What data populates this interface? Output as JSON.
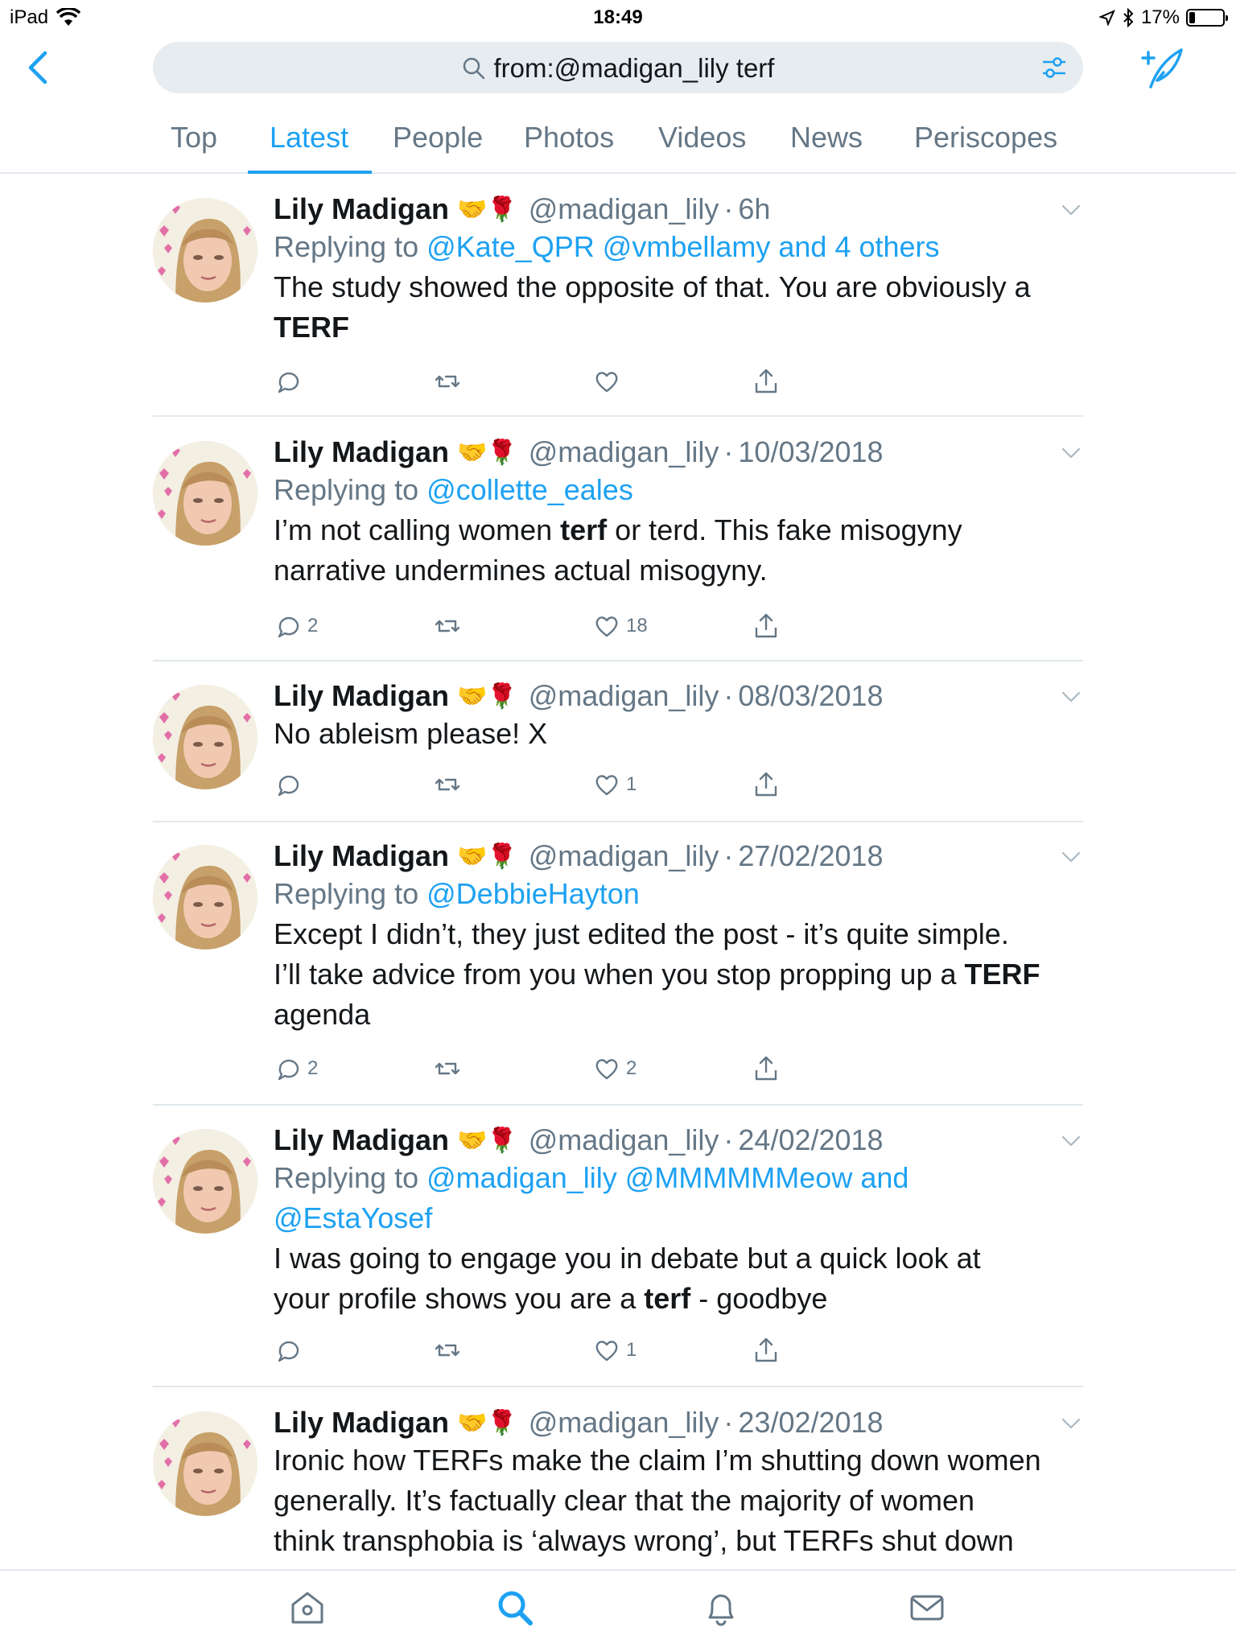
{
  "status_bar": {
    "device": "iPad",
    "time": "18:49",
    "battery": "17%",
    "battery_level": 0.17
  },
  "search": {
    "query": "from:@madigan_lily terf",
    "icon": "search-icon",
    "filter_icon": "filter-icon"
  },
  "tabs": [
    "Top",
    "Latest",
    "People",
    "Photos",
    "Videos",
    "News",
    "Periscopes"
  ],
  "active_tab": "Latest",
  "tweets": [
    {
      "name": "Lily Madigan",
      "emoji": "🤝🌹",
      "handle": "@madigan_lily",
      "dot": "·",
      "time": "6h",
      "replying_prefix": "Replying to",
      "replying": [
        {
          "text": "@Kate_QPR",
          "sep": " "
        },
        {
          "text": "@vmbellamy",
          "sep": " "
        },
        {
          "text": "and 4 others",
          "sep": ""
        }
      ],
      "text_lines": [
        [
          {
            "t": "The study showed the opposite of that. You are obviously a",
            "b": false
          }
        ],
        [
          {
            "t": "TERF",
            "b": true
          }
        ]
      ],
      "replies": "",
      "likes": ""
    },
    {
      "name": "Lily Madigan",
      "emoji": "🤝🌹",
      "handle": "@madigan_lily",
      "dot": "·",
      "time": "10/03/2018",
      "replying_prefix": "Replying to",
      "replying": [
        {
          "text": "@collette_eales",
          "sep": ""
        }
      ],
      "text_lines": [
        [
          {
            "t": "I’m not calling women ",
            "b": false
          },
          {
            "t": "terf",
            "b": true
          },
          {
            "t": " or terd. This fake misogyny",
            "b": false
          }
        ],
        [
          {
            "t": "narrative undermines actual misogyny.",
            "b": false
          }
        ]
      ],
      "replies": "2",
      "likes": "18"
    },
    {
      "name": "Lily Madigan",
      "emoji": "🤝🌹",
      "handle": "@madigan_lily",
      "dot": "·",
      "time": "08/03/2018",
      "replying_prefix": "",
      "replying": [],
      "text_lines": [
        [
          {
            "t": "No ableism please! X",
            "b": false
          }
        ]
      ],
      "replies": "",
      "likes": "1"
    },
    {
      "name": "Lily Madigan",
      "emoji": "🤝🌹",
      "handle": "@madigan_lily",
      "dot": "·",
      "time": "27/02/2018",
      "replying_prefix": "Replying to",
      "replying": [
        {
          "text": "@DebbieHayton",
          "sep": ""
        }
      ],
      "text_lines": [
        [
          {
            "t": "Except I didn’t, they just edited the post - it’s quite simple.",
            "b": false
          }
        ],
        [
          {
            "t": "I’ll take advice from you when you stop propping up a ",
            "b": false
          },
          {
            "t": "TERF",
            "b": true
          }
        ],
        [
          {
            "t": "agenda",
            "b": false
          }
        ]
      ],
      "replies": "2",
      "likes": "2"
    },
    {
      "name": "Lily Madigan",
      "emoji": "🤝🌹",
      "handle": "@madigan_lily",
      "dot": "·",
      "time": "24/02/2018",
      "replying_prefix": "Replying to",
      "replying": [
        {
          "text": "@madigan_lily",
          "sep": " "
        },
        {
          "text": "@MMMMMMeow",
          "sep": " "
        },
        {
          "text": "and",
          "sep": "\n"
        },
        {
          "text": "@EstaYosef",
          "sep": ""
        }
      ],
      "text_lines": [
        [
          {
            "t": "I was going to engage you in debate but a quick look at",
            "b": false
          }
        ],
        [
          {
            "t": "your profile shows you are a ",
            "b": false
          },
          {
            "t": "terf",
            "b": true
          },
          {
            "t": " - goodbye",
            "b": false
          }
        ]
      ],
      "replies": "",
      "likes": "1"
    },
    {
      "name": "Lily Madigan",
      "emoji": "🤝🌹",
      "handle": "@madigan_lily",
      "dot": "·",
      "time": "23/02/2018",
      "replying_prefix": "",
      "replying": [],
      "text_lines": [
        [
          {
            "t": "Ironic how TERFs make the claim I’m shutting down women",
            "b": false
          }
        ],
        [
          {
            "t": "generally. It’s factually clear that the majority of women",
            "b": false
          }
        ],
        [
          {
            "t": "think transphobia is ‘always wrong’, but TERFs shut down",
            "b": false
          }
        ]
      ],
      "replies": "",
      "likes": ""
    }
  ],
  "bottom_nav": [
    "home-icon",
    "search-icon",
    "notifications-icon",
    "messages-icon"
  ],
  "colors": {
    "accent": "#1da1f2",
    "muted": "#657786",
    "text": "#14171a",
    "divider": "#e1e8ed"
  }
}
